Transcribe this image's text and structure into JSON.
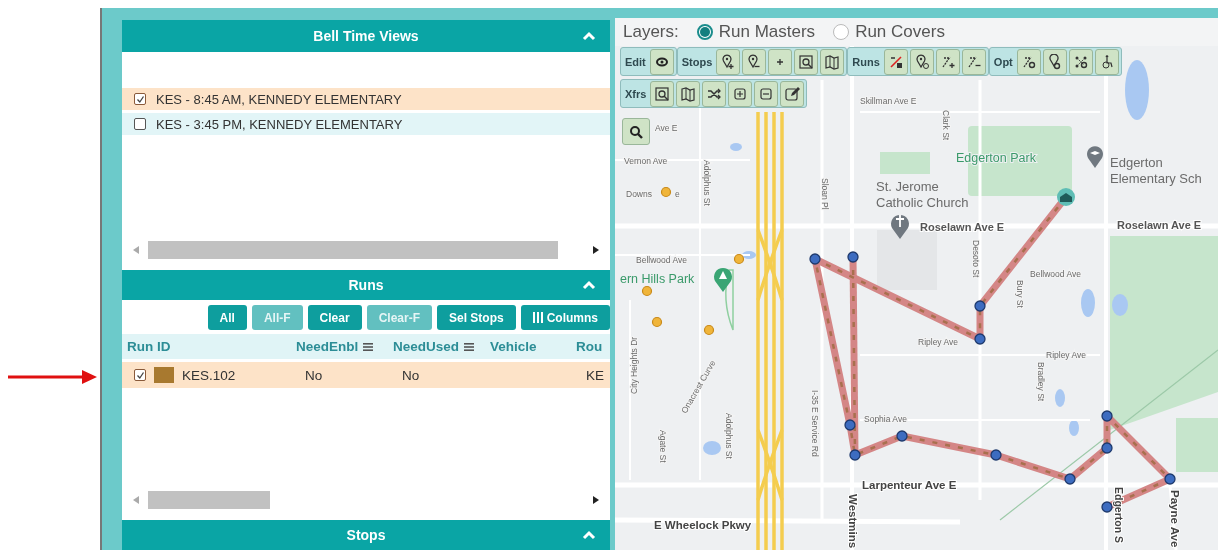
{
  "bell_time_views": {
    "title": "Bell Time Views",
    "items": [
      {
        "label": "KES - 8:45 AM, KENNEDY ELEMENTARY",
        "checked": true,
        "selected": true
      },
      {
        "label": "KES - 3:45 PM, KENNEDY ELEMENTARY",
        "checked": false,
        "selected": false
      }
    ]
  },
  "runs": {
    "title": "Runs",
    "buttons": [
      {
        "label": "All",
        "kind": "text",
        "disabled": false
      },
      {
        "label": "All-F",
        "kind": "text",
        "disabled": true
      },
      {
        "label": "Clear",
        "kind": "text",
        "disabled": false
      },
      {
        "label": "Clear-F",
        "kind": "text",
        "disabled": true
      },
      {
        "label": "Sel Stops",
        "kind": "text",
        "disabled": false
      },
      {
        "label": "Columns",
        "kind": "columns",
        "disabled": false
      }
    ],
    "columns": [
      {
        "label": "Run ID",
        "menu": false
      },
      {
        "label": "NeedEnbl",
        "menu": true
      },
      {
        "label": "NeedUsed",
        "menu": true
      },
      {
        "label": "Vehicle",
        "menu": false
      },
      {
        "label": "Rou",
        "menu": false
      }
    ],
    "rows": [
      {
        "checked": true,
        "selected": true,
        "color": "#a8792f",
        "run_id": "KES.102",
        "need_enbl": "No",
        "need_used": "No",
        "route": "KE"
      }
    ]
  },
  "stops": {
    "title": "Stops"
  },
  "map": {
    "layers": {
      "label": "Layers:",
      "options": [
        {
          "label": "Run Masters",
          "selected": true
        },
        {
          "label": "Run Covers",
          "selected": false
        }
      ]
    },
    "toolbar": [
      {
        "label": "Edit"
      },
      {
        "label": "Stops"
      },
      {
        "label": "Runs"
      },
      {
        "label": "Opt"
      },
      {
        "label": "Xfrs"
      }
    ],
    "labels": [
      "Skillman Ave E",
      "Clark St",
      "Ave E",
      "Vernon Ave",
      "Adolphus St",
      "Downs",
      "e",
      "Sloan Pl",
      "Edgerton Park",
      "Edgerton",
      "Elementary Sch",
      "St. Jerome",
      "Catholic Church",
      "Roselawn Ave E",
      "Roselawn Ave E",
      "Desoto St",
      "Bellwood Ave",
      "Bellwood Ave",
      "ern Hills Park",
      "Bury St",
      "Ripley Ave",
      "Ripley Ave",
      "City Heights Dr",
      "Bradley St",
      "Onacrest Curve",
      "Sophia Ave",
      "I-35 E Service Rd",
      "Adolphus St",
      "Agate St",
      "Larpenteur Ave E",
      "Westmins",
      "Edgerton S",
      "Payne Ave",
      "E Wheelock Pkwy"
    ]
  }
}
